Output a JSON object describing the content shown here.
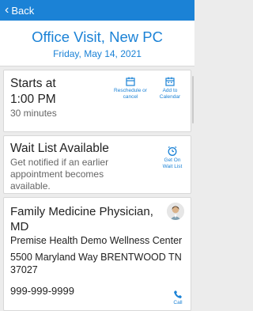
{
  "nav": {
    "back_label": "Back"
  },
  "header": {
    "title": "Office Visit, New PC",
    "date": "Friday, May 14, 2021"
  },
  "appointment": {
    "starts_label": "Starts at",
    "time": "1:00 PM",
    "duration": "30 minutes",
    "reschedule_label": "Reschedule or cancel",
    "calendar_label": "Add to Calendar"
  },
  "waitlist": {
    "title": "Wait List Available",
    "description": "Get notified if an earlier appointment becomes available.",
    "button_label": "Get On Wait List"
  },
  "provider": {
    "specialty": "Family Medicine Physician, MD",
    "location_name": "Premise Health Demo Wellness Center",
    "address": "5500 Maryland Way BRENTWOOD TN 37027",
    "phone": "999-999-9999",
    "call_label": "Call"
  },
  "colors": {
    "accent": "#1b82d6",
    "background": "#ececec"
  }
}
